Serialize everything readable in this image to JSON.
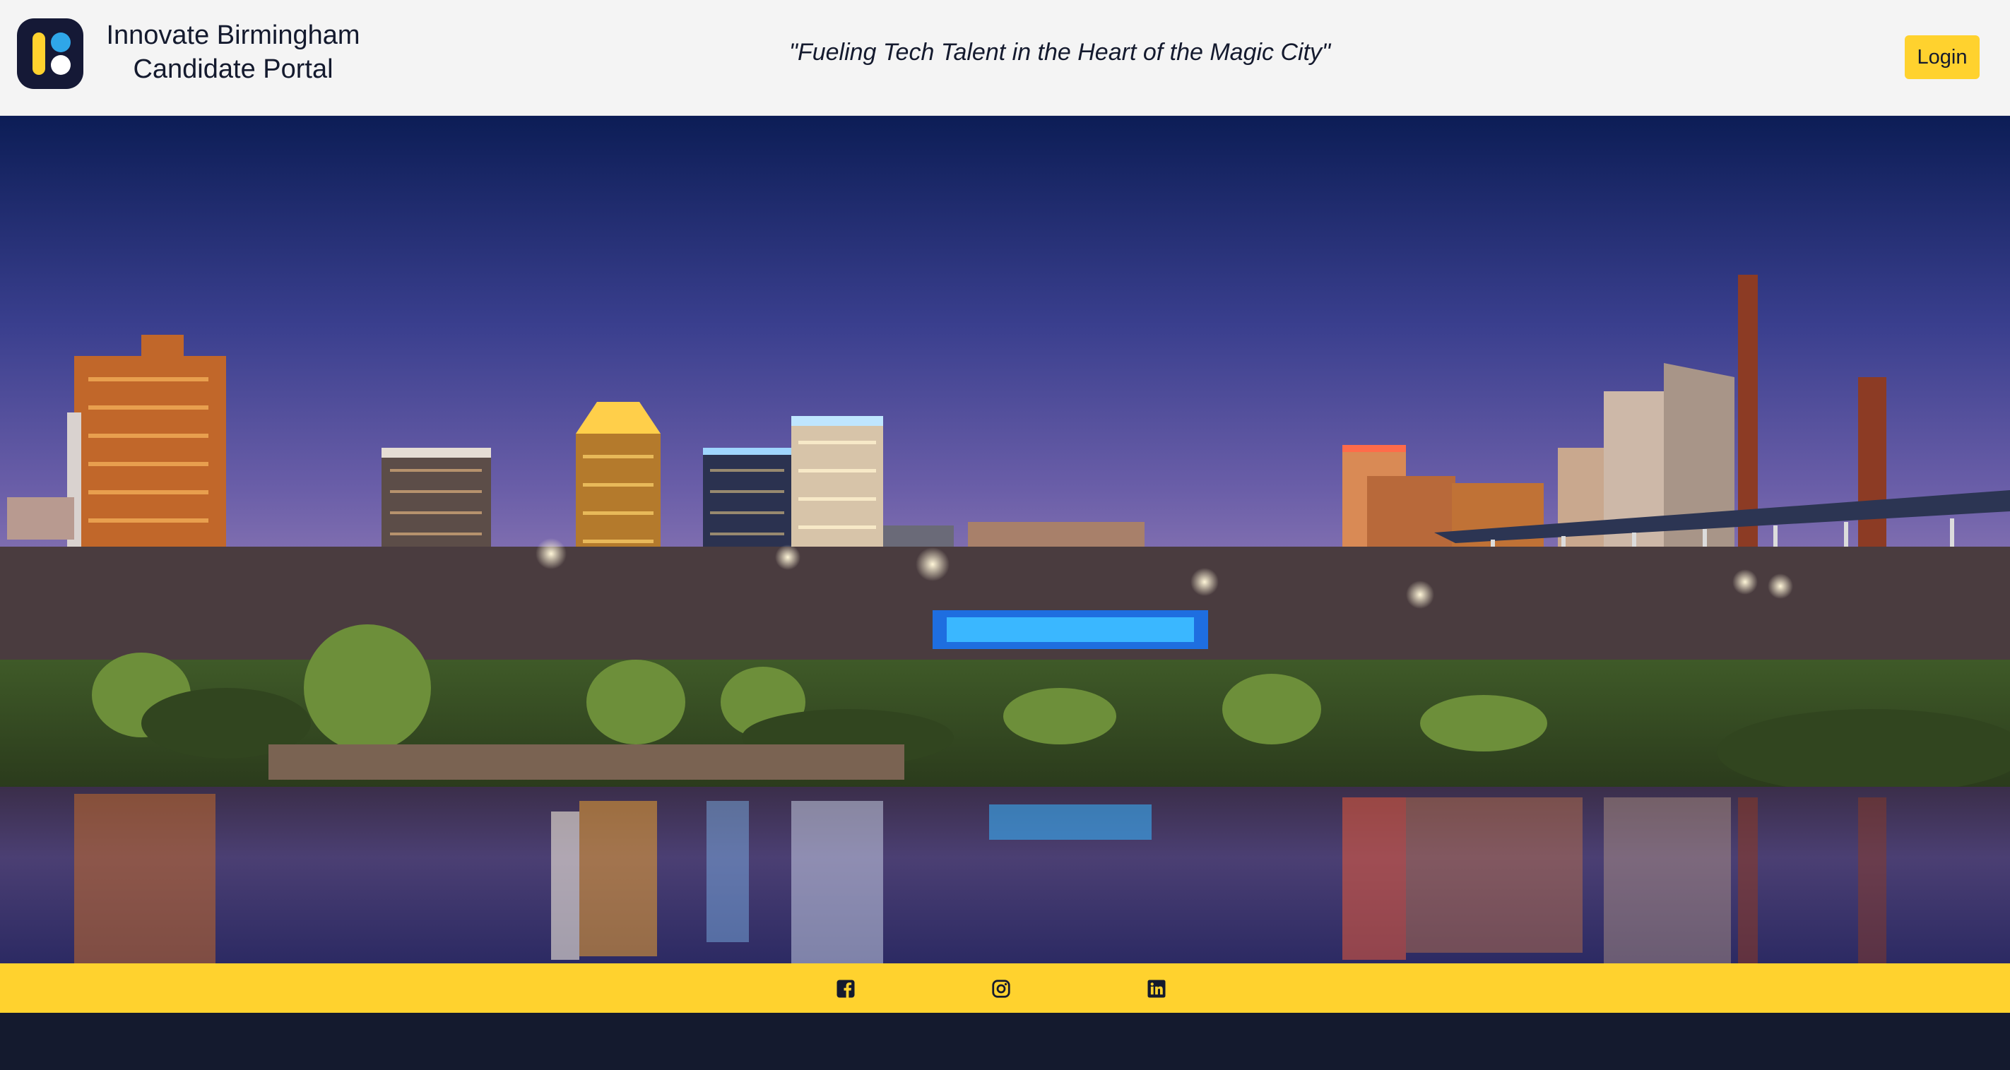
{
  "header": {
    "brand_line1": "Innovate Birmingham",
    "brand_line2": "Candidate Portal",
    "tagline": "\"Fueling Tech Talent in the Heart of the Magic City\"",
    "login_label": "Login",
    "logo_icon": "innovate-birmingham-logo"
  },
  "social": {
    "icons": [
      "facebook-icon",
      "instagram-icon",
      "linkedin-icon"
    ]
  },
  "colors": {
    "accent": "#ffd22e",
    "navy": "#141a2e",
    "logo_blue": "#2fa6e8",
    "header_bg": "#f4f4f4"
  }
}
